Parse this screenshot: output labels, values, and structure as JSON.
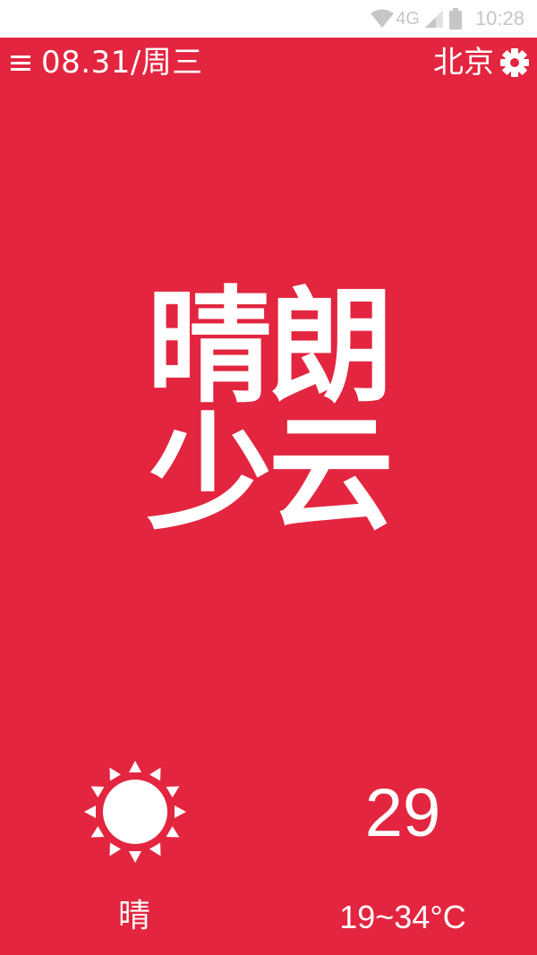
{
  "status_bar": {
    "network": "4G",
    "time": "10:28",
    "icons": [
      "wifi-icon",
      "cell-signal-icon",
      "battery-icon"
    ]
  },
  "header": {
    "menu_icon": "menu-icon",
    "date": "08.31/周三",
    "city": "北京",
    "settings_icon": "gear-icon"
  },
  "hero": {
    "line1": "晴朗",
    "line2": "少云"
  },
  "today": {
    "icon": "sun-icon",
    "condition": "晴",
    "current_temp": "29",
    "range": "19~34°C"
  },
  "colors": {
    "background": "#e3253f",
    "text": "#ffffff",
    "status_bar_bg": "#ffffff",
    "status_bar_fg": "#c6c6c6"
  }
}
